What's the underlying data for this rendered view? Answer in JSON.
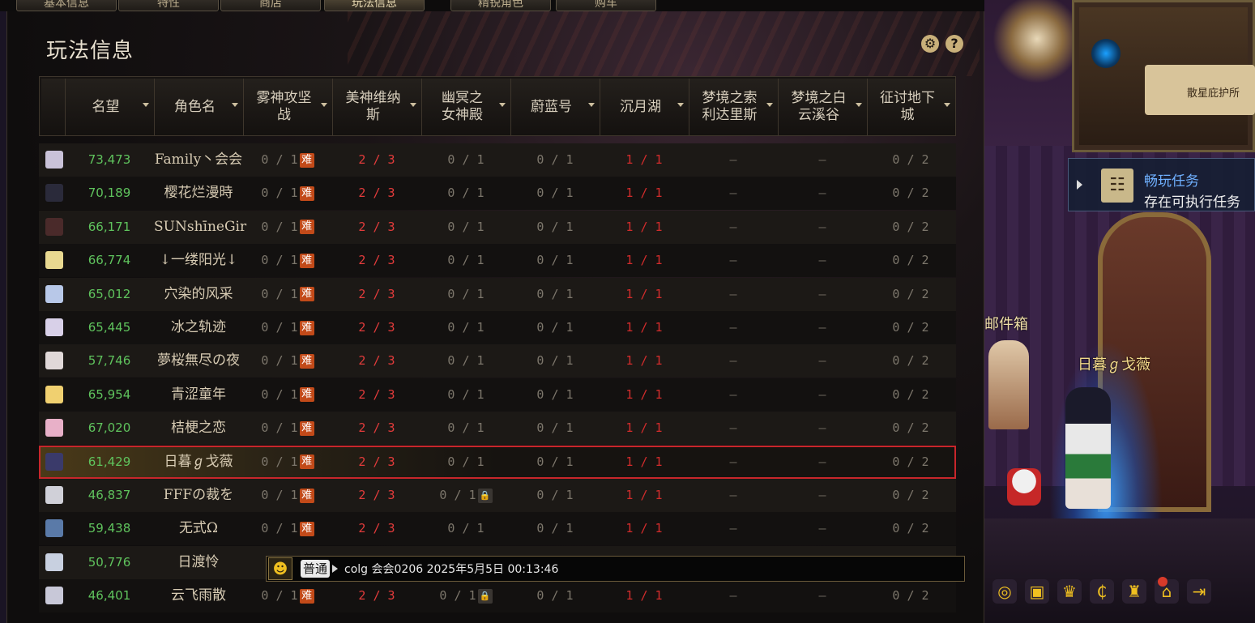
{
  "top_tabs": [
    {
      "label": "基本信息",
      "active": false
    },
    {
      "label": "特性",
      "active": false
    },
    {
      "label": "商店",
      "active": false
    },
    {
      "label": "玩法信息",
      "active": true
    },
    {
      "label": "精锐角色",
      "active": false
    },
    {
      "label": "购车",
      "active": false
    }
  ],
  "panel": {
    "title": "玩法信息",
    "settings_icon": "gear-icon",
    "help_icon": "question-icon",
    "help_glyph": "?"
  },
  "table": {
    "columns": [
      {
        "label": "",
        "sortable": false
      },
      {
        "label": "名望",
        "sortable": true
      },
      {
        "label": "角色名",
        "sortable": true
      },
      {
        "label": "雾神攻坚战",
        "sortable": true
      },
      {
        "label": "美神维纳斯",
        "sortable": true
      },
      {
        "label": "幽冥之女神殿",
        "sortable": true
      },
      {
        "label": "蔚蓝号",
        "sortable": true
      },
      {
        "label": "沉月湖",
        "sortable": true
      },
      {
        "label": "梦境之索利达里斯",
        "sortable": true
      },
      {
        "label": "梦境之白云溪谷",
        "sortable": true
      },
      {
        "label": "征讨地下城",
        "sortable": true
      }
    ],
    "hard_label": "难",
    "rows": [
      {
        "fame": "73,473",
        "name": "Family丶会会",
        "wushen": "0 / 1",
        "hard": true,
        "meishen": "2 / 3",
        "youming": "0 / 1",
        "youming_lock": false,
        "weilan": "0 / 1",
        "chenyue": "1 / 1",
        "suolida": "–",
        "baiyun": "–",
        "zhengtao": "0 / 2",
        "selected": false,
        "avatar_color": "#c9c2d8"
      },
      {
        "fame": "70,189",
        "name": "樱花烂漫時",
        "wushen": "0 / 1",
        "hard": true,
        "meishen": "2 / 3",
        "youming": "0 / 1",
        "youming_lock": false,
        "weilan": "0 / 1",
        "chenyue": "1 / 1",
        "suolida": "–",
        "baiyun": "–",
        "zhengtao": "0 / 2",
        "selected": false,
        "avatar_color": "#2a2a3a"
      },
      {
        "fame": "66,171",
        "name": "SUNshīneGir",
        "wushen": "0 / 1",
        "hard": true,
        "meishen": "2 / 3",
        "youming": "0 / 1",
        "youming_lock": false,
        "weilan": "0 / 1",
        "chenyue": "1 / 1",
        "suolida": "–",
        "baiyun": "–",
        "zhengtao": "0 / 2",
        "selected": false,
        "avatar_color": "#4a2a2a"
      },
      {
        "fame": "66,774",
        "name": "↓一缕阳光↓",
        "wushen": "0 / 1",
        "hard": true,
        "meishen": "2 / 3",
        "youming": "0 / 1",
        "youming_lock": false,
        "weilan": "0 / 1",
        "chenyue": "1 / 1",
        "suolida": "–",
        "baiyun": "–",
        "zhengtao": "0 / 2",
        "selected": false,
        "avatar_color": "#e8d890"
      },
      {
        "fame": "65,012",
        "name": "穴染的风采",
        "wushen": "0 / 1",
        "hard": true,
        "meishen": "2 / 3",
        "youming": "0 / 1",
        "youming_lock": false,
        "weilan": "0 / 1",
        "chenyue": "1 / 1",
        "suolida": "–",
        "baiyun": "–",
        "zhengtao": "0 / 2",
        "selected": false,
        "avatar_color": "#b8c8e8"
      },
      {
        "fame": "65,445",
        "name": "冰之轨迹",
        "wushen": "0 / 1",
        "hard": true,
        "meishen": "2 / 3",
        "youming": "0 / 1",
        "youming_lock": false,
        "weilan": "0 / 1",
        "chenyue": "1 / 1",
        "suolida": "–",
        "baiyun": "–",
        "zhengtao": "0 / 2",
        "selected": false,
        "avatar_color": "#d8d0e8"
      },
      {
        "fame": "57,746",
        "name": "夢桜無尽の夜",
        "wushen": "0 / 1",
        "hard": true,
        "meishen": "2 / 3",
        "youming": "0 / 1",
        "youming_lock": false,
        "weilan": "0 / 1",
        "chenyue": "1 / 1",
        "suolida": "–",
        "baiyun": "–",
        "zhengtao": "0 / 2",
        "selected": false,
        "avatar_color": "#e0d8d8"
      },
      {
        "fame": "65,954",
        "name": "青涩童年",
        "wushen": "0 / 1",
        "hard": true,
        "meishen": "2 / 3",
        "youming": "0 / 1",
        "youming_lock": false,
        "weilan": "0 / 1",
        "chenyue": "1 / 1",
        "suolida": "–",
        "baiyun": "–",
        "zhengtao": "0 / 2",
        "selected": false,
        "avatar_color": "#f0d070"
      },
      {
        "fame": "67,020",
        "name": "桔梗之恋",
        "wushen": "0 / 1",
        "hard": true,
        "meishen": "2 / 3",
        "youming": "0 / 1",
        "youming_lock": false,
        "weilan": "0 / 1",
        "chenyue": "1 / 1",
        "suolida": "–",
        "baiyun": "–",
        "zhengtao": "0 / 2",
        "selected": false,
        "avatar_color": "#e8b0c8"
      },
      {
        "fame": "61,429",
        "name": "日暮ℊ戈薇",
        "wushen": "0 / 1",
        "hard": true,
        "meishen": "2 / 3",
        "youming": "0 / 1",
        "youming_lock": false,
        "weilan": "0 / 1",
        "chenyue": "1 / 1",
        "suolida": "–",
        "baiyun": "–",
        "zhengtao": "0 / 2",
        "selected": true,
        "avatar_color": "#3a3a6a"
      },
      {
        "fame": "46,837",
        "name": "FFFの裁を",
        "wushen": "0 / 1",
        "hard": true,
        "meishen": "2 / 3",
        "youming": "0 / 1",
        "youming_lock": true,
        "weilan": "0 / 1",
        "chenyue": "1 / 1",
        "suolida": "–",
        "baiyun": "–",
        "zhengtao": "0 / 2",
        "selected": false,
        "avatar_color": "#d0d0d8"
      },
      {
        "fame": "59,438",
        "name": "无式Ω",
        "wushen": "0 / 1",
        "hard": true,
        "meishen": "2 / 3",
        "youming": "0 / 1",
        "youming_lock": false,
        "weilan": "0 / 1",
        "chenyue": "1 / 1",
        "suolida": "–",
        "baiyun": "–",
        "zhengtao": "0 / 2",
        "selected": false,
        "avatar_color": "#5a7aa8"
      },
      {
        "fame": "50,776",
        "name": "日渡怜",
        "wushen": "",
        "hard": false,
        "meishen": "",
        "youming": "",
        "youming_lock": false,
        "weilan": "",
        "chenyue": "",
        "suolida": "",
        "baiyun": "",
        "zhengtao": "",
        "selected": false,
        "avatar_color": "#c8d0e0"
      },
      {
        "fame": "46,401",
        "name": "云飞雨散",
        "wushen": "0 / 1",
        "hard": true,
        "meishen": "2 / 3",
        "youming": "0 / 1",
        "youming_lock": true,
        "weilan": "0 / 1",
        "chenyue": "1 / 1",
        "suolida": "–",
        "baiyun": "–",
        "zhengtao": "0 / 2",
        "selected": false,
        "avatar_color": "#c8c8d8"
      }
    ]
  },
  "chat": {
    "channel": "普通",
    "message": "colg 会会0206 2025年5月5日 00:13:46"
  },
  "scene": {
    "minimap_label": "散星庇护所",
    "quest_title": "畅玩任务",
    "quest_subtitle": "存在可执行任务",
    "mailbox_label": "邮件箱",
    "character_name": "日暮ℊ戈薇"
  }
}
